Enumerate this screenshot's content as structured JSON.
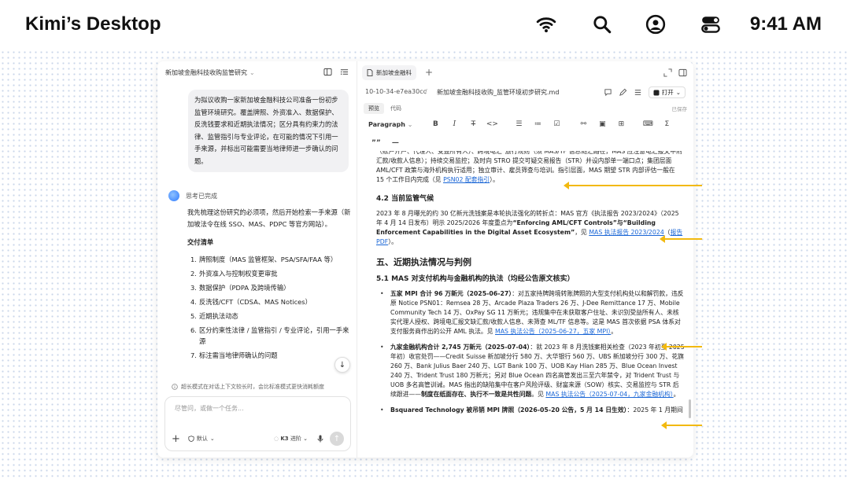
{
  "menubar": {
    "title": "Kimi’s Desktop",
    "time": "9:41 AM",
    "icons": [
      "wifi-icon",
      "search-icon",
      "user-icon",
      "control-center-icon"
    ]
  },
  "chat": {
    "header_title": "新加坡金融科技收购监管研究",
    "user_message": "为拟议收购一家新加坡金融科技公司准备一份初步监管环境研究。覆盖牌照、外资准入、数据保护、反洗钱要求和近期执法情况；区分具有约束力的法律、监管指引与专业评论，在可能的情况下引用一手来源，并标出可能需要当地律师进一步确认的问题。",
    "thought_label": "思考已完成",
    "answer_intro": "我先梳理这份研究的必须项，然后开始检索一手来源（新加坡法令在线 SSO、MAS、PDPC 等官方网站）。",
    "checklist_title": "交付清单",
    "checklist": [
      "牌照制度（MAS 监管框架、PSA/SFA/FAA 等）",
      "外资准入与控制权变更审批",
      "数据保护（PDPA 及跨境传输）",
      "反洗钱/CFT（CDSA、MAS Notices）",
      "近期执法动态",
      "区分约束性法律 / 监管指引 / 专业评论，引用一手来源",
      "标注需当地律师确认的问题"
    ],
    "notice": "超长模式在对话上下文较长时，会比标准模式更快消耗额度",
    "input_placeholder": "尽管问，或做一个任务...",
    "mode_label": "默认",
    "model_name": "K3",
    "model_variant": "进阶"
  },
  "doc": {
    "tab_title": "新加坡金融科",
    "path_id": "10-10-34-e7ea30cc",
    "filename": "新加坡金融科技收购_监管环境初步研究.md",
    "open_label": "打开",
    "modes": [
      "预览",
      "代码"
    ],
    "saved": "已保存",
    "toolbar": {
      "paragraph": "Paragraph",
      "bold": "B",
      "italic": "I",
      "strike": "T",
      "code": "<>",
      "quote": "””",
      "rule": "—",
      "sigma": "Σ"
    },
    "p1": "（账户开户、代理人、受益所有人）、跨境电汇“旅行规则”（须 MAS/TF 信息随汇路径，MAS 应注意电汇报文中附汇款/收款人信息）；持续交易监控；及时向 STRO 提交可疑交易报告（STR）并设内部单一端口点；集团层面 AML/CFT 政策与海外机构执行适用；独立审计、雇员筛查与培训。指引层面，MAS 期望 STR 内部评估一般在 15 个工作日内完成（见 ",
    "p1_link": "PSN02 配套指引",
    "p1_tail": "）。",
    "h42": "4.2 当前监管气候",
    "p2a": "2023 年 8 月曝光的约 30 亿新元洗钱案是本轮执法强化的转折点：MAS 官方《执法报告 2023/2024》（2025 年 4 月 14 日发布）明示 2025/2026 年度重点为",
    "p2b": "“Enforcing AML/CFT Controls”与“Building Enforcement Capabilities in the Digital Asset Ecosystem”",
    "p2c": "，见 ",
    "p2_link1": "MAS 执法报告 2023/2024",
    "p2_mid": "（",
    "p2_link2": "报告 PDF",
    "p2_tail": "）。",
    "h5": "五、近期执法情况与判例",
    "h51": "5.1 MAS 对支付机构与金融机构的执法（均经公告原文核实）",
    "b1_title": "五家 MPI 合计 96 万新元（2025-06-27）",
    "b1_text": "：对五家持牌跨境转账牌照的大型支付机构处以和解罚款，违反原 Notice PSN01：Remsea 28 万、Arcade Plaza Traders 26 万、J-Dee Remittance 17 万、Mobile Community Tech 14 万、OxPay SG 11 万新元；违规集中在未获取客户住址、未识别受益所有人、未核实代理人授权、跨境电汇报文缺汇款/收款人信息、未筛查 ML/TF 信息等。这是 MAS 首次依据 PSA 体系对支付服务商作出的公开 AML 执法。见 ",
    "b1_link": "MAS 执法公告（2025-06-27，五家 MPI）",
    "b1_tail": "。",
    "b2_title": "九家金融机构合计 2,745 万新元（2025-07-04）",
    "b2_text": "：就 2023 年 8 月洗钱案相关检查（2023 年初至 2025 年初）收官处罚——Credit Suisse 新加坡分行 580 万、大华银行 560 万、UBS 新加坡分行 300 万、花旗 260 万、Bank Julius Baer 240 万、LGT Bank 100 万、UOB Kay Hian 285 万、Blue Ocean Invest 240 万、Trident Trust 180 万新元；另对 Blue Ocean 四名高管发出三至六年禁令，对 Trident Trust 与 UOB 多名高管训诫。MAS 指出的缺陷集中在客户风险评级、财富来源（SOW）核实、交易监控与 STR 后续跟进——",
    "b2_bold": "制度在纸面存在、执行不一致是共性问题",
    "b2_mid": "。见 ",
    "b2_link": "MAS 执法公告（2025-07-04，九家金融机构）",
    "b2_tail": "。",
    "b3_title": "Bsquared Technology 被吊销 MPI 牌照（2026-05-20 公告，5 月 14 日生效）",
    "b3_text": "：2025 年 1 月期间"
  },
  "accent_color": "#f2b90f",
  "link_color": "#1a66d6"
}
